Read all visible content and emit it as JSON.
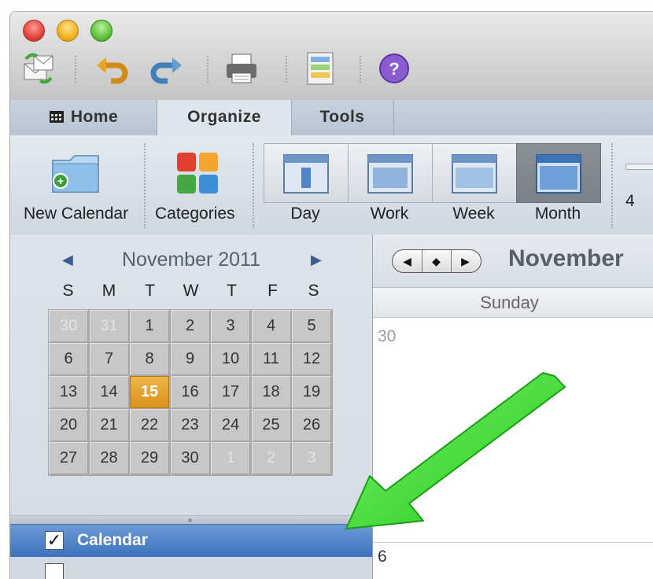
{
  "toolbar": {
    "icons": [
      "send-receive-icon",
      "undo-icon",
      "redo-icon",
      "print-icon",
      "note-icon",
      "help-icon"
    ],
    "help_glyph": "?"
  },
  "tabs": [
    {
      "label": "Home",
      "icon": "calendar-icon"
    },
    {
      "label": "Organize"
    },
    {
      "label": "Tools"
    }
  ],
  "ribbon": {
    "new_calendar": "New Calendar",
    "categories": "Categories",
    "views": [
      "Day",
      "Work",
      "Week",
      "Month"
    ],
    "active_view": "Month",
    "slider_min": "4"
  },
  "mini_calendar": {
    "title": "November 2011",
    "prev": "◀",
    "next": "▶",
    "weekdays": [
      "S",
      "M",
      "T",
      "W",
      "T",
      "F",
      "S"
    ],
    "weeks": [
      [
        "30",
        "31",
        "1",
        "2",
        "3",
        "4",
        "5"
      ],
      [
        "6",
        "7",
        "8",
        "9",
        "10",
        "11",
        "12"
      ],
      [
        "13",
        "14",
        "15",
        "16",
        "17",
        "18",
        "19"
      ],
      [
        "20",
        "21",
        "22",
        "23",
        "24",
        "25",
        "26"
      ],
      [
        "27",
        "28",
        "29",
        "30",
        "1",
        "2",
        "3"
      ]
    ],
    "today": "15"
  },
  "calendars": [
    {
      "name": "Calendar",
      "checked": true,
      "check_glyph": "✓"
    }
  ],
  "main": {
    "nav_prev": "◀",
    "nav_today": "◆",
    "nav_next": "▶",
    "month_title": "November",
    "day_header": "Sunday",
    "first_date": "30",
    "second_date": "6"
  },
  "colors": {
    "today": "#e6a22f",
    "selected_row": "#3c71bd",
    "annotation_arrow": "#33dd22"
  }
}
